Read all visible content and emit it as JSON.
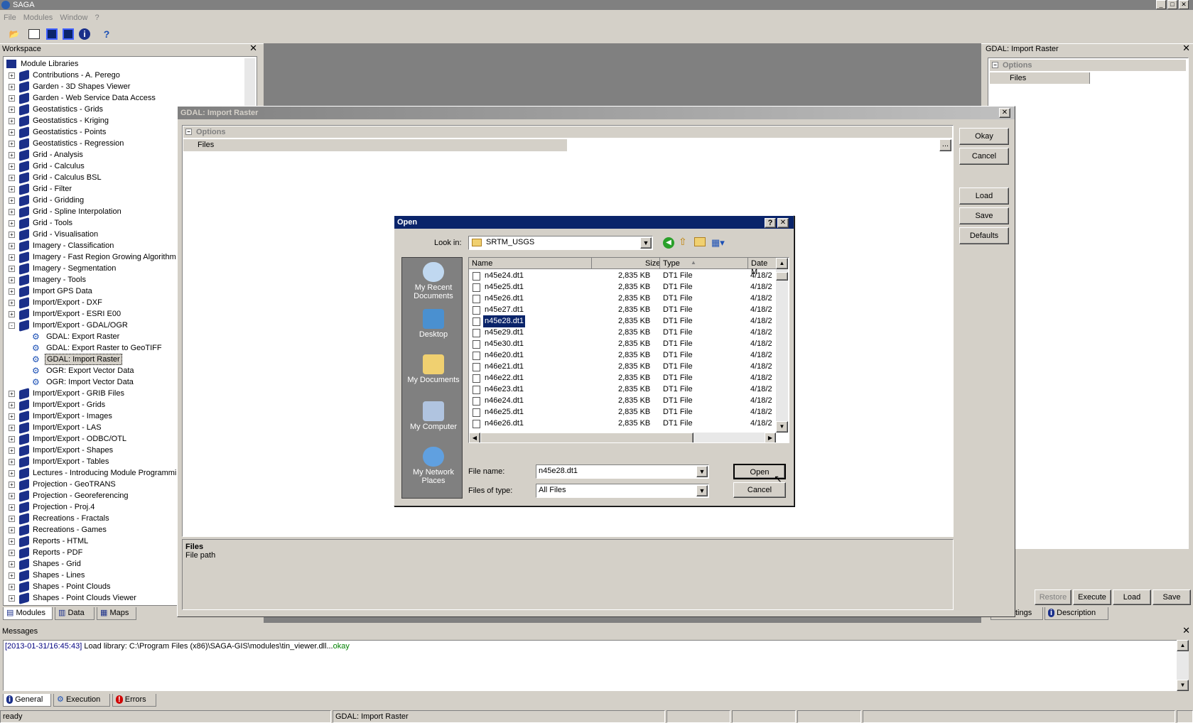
{
  "app": {
    "title": "SAGA",
    "window_buttons": [
      "_",
      "□",
      "✕"
    ]
  },
  "menu": [
    "File",
    "Modules",
    "Window",
    "?"
  ],
  "toolbar_icons": [
    "open-icon",
    "console-icon",
    "window-blue-icon",
    "window-blue2-icon",
    "info-icon",
    "help-icon"
  ],
  "workspace": {
    "title": "Workspace",
    "root": "Module Libraries",
    "items": [
      {
        "label": "Contributions - A. Perego",
        "exp": "+"
      },
      {
        "label": "Garden - 3D Shapes Viewer",
        "exp": "+"
      },
      {
        "label": "Garden - Web Service Data Access",
        "exp": "+"
      },
      {
        "label": "Geostatistics - Grids",
        "exp": "+"
      },
      {
        "label": "Geostatistics - Kriging",
        "exp": "+"
      },
      {
        "label": "Geostatistics - Points",
        "exp": "+"
      },
      {
        "label": "Geostatistics - Regression",
        "exp": "+"
      },
      {
        "label": "Grid - Analysis",
        "exp": "+"
      },
      {
        "label": "Grid - Calculus",
        "exp": "+"
      },
      {
        "label": "Grid - Calculus BSL",
        "exp": "+"
      },
      {
        "label": "Grid - Filter",
        "exp": "+"
      },
      {
        "label": "Grid - Gridding",
        "exp": "+"
      },
      {
        "label": "Grid - Spline Interpolation",
        "exp": "+"
      },
      {
        "label": "Grid - Tools",
        "exp": "+"
      },
      {
        "label": "Grid - Visualisation",
        "exp": "+"
      },
      {
        "label": "Imagery - Classification",
        "exp": "+"
      },
      {
        "label": "Imagery - Fast Region Growing Algorithm",
        "exp": "+"
      },
      {
        "label": "Imagery - Segmentation",
        "exp": "+"
      },
      {
        "label": "Imagery - Tools",
        "exp": "+"
      },
      {
        "label": "Import GPS Data",
        "exp": "+"
      },
      {
        "label": "Import/Export - DXF",
        "exp": "+"
      },
      {
        "label": "Import/Export - ESRI E00",
        "exp": "+"
      },
      {
        "label": "Import/Export - GDAL/OGR",
        "exp": "-"
      },
      {
        "label": "GDAL: Export Raster",
        "child": true
      },
      {
        "label": "GDAL: Export Raster to GeoTIFF",
        "child": true
      },
      {
        "label": "GDAL: Import Raster",
        "child": true,
        "selected": true
      },
      {
        "label": "OGR: Export Vector Data",
        "child": true
      },
      {
        "label": "OGR: Import Vector Data",
        "child": true
      },
      {
        "label": "Import/Export - GRIB Files",
        "exp": "+"
      },
      {
        "label": "Import/Export - Grids",
        "exp": "+"
      },
      {
        "label": "Import/Export - Images",
        "exp": "+"
      },
      {
        "label": "Import/Export - LAS",
        "exp": "+"
      },
      {
        "label": "Import/Export - ODBC/OTL",
        "exp": "+"
      },
      {
        "label": "Import/Export - Shapes",
        "exp": "+"
      },
      {
        "label": "Import/Export - Tables",
        "exp": "+"
      },
      {
        "label": "Lectures - Introducing Module Programmin",
        "exp": "+"
      },
      {
        "label": "Projection - GeoTRANS",
        "exp": "+"
      },
      {
        "label": "Projection - Georeferencing",
        "exp": "+"
      },
      {
        "label": "Projection - Proj.4",
        "exp": "+"
      },
      {
        "label": "Recreations - Fractals",
        "exp": "+"
      },
      {
        "label": "Recreations - Games",
        "exp": "+"
      },
      {
        "label": "Reports - HTML",
        "exp": "+"
      },
      {
        "label": "Reports - PDF",
        "exp": "+"
      },
      {
        "label": "Shapes - Grid",
        "exp": "+"
      },
      {
        "label": "Shapes - Lines",
        "exp": "+"
      },
      {
        "label": "Shapes - Point Clouds",
        "exp": "+"
      },
      {
        "label": "Shapes - Point Clouds Viewer",
        "exp": "+"
      }
    ],
    "tabs": [
      "Modules",
      "Data",
      "Maps"
    ]
  },
  "right_panel": {
    "title": "GDAL: Import Raster",
    "options": "Options",
    "files": "Files",
    "buttons": [
      "Restore",
      "Execute",
      "Load",
      "Save"
    ],
    "tabs": [
      "Settings",
      "Description"
    ]
  },
  "import_dialog": {
    "title": "GDAL: Import Raster",
    "options": "Options",
    "files": "Files",
    "browse": "...",
    "buttons": {
      "okay": "Okay",
      "cancel": "Cancel",
      "load": "Load",
      "save": "Save",
      "defaults": "Defaults"
    },
    "desc_title": "Files",
    "desc_text": "File path"
  },
  "open_dialog": {
    "title": "Open",
    "help": "?",
    "look_in_label": "Look in:",
    "look_in_value": "SRTM_USGS",
    "places": [
      "My Recent Documents",
      "Desktop",
      "My Documents",
      "My Computer",
      "My Network Places"
    ],
    "columns": {
      "name": "Name",
      "size": "Size",
      "type": "Type",
      "date": "Date M"
    },
    "files": [
      {
        "name": "n45e24.dt1",
        "size": "2,835 KB",
        "type": "DT1 File",
        "date": "4/18/2"
      },
      {
        "name": "n45e25.dt1",
        "size": "2,835 KB",
        "type": "DT1 File",
        "date": "4/18/2"
      },
      {
        "name": "n45e26.dt1",
        "size": "2,835 KB",
        "type": "DT1 File",
        "date": "4/18/2"
      },
      {
        "name": "n45e27.dt1",
        "size": "2,835 KB",
        "type": "DT1 File",
        "date": "4/18/2"
      },
      {
        "name": "n45e28.dt1",
        "size": "2,835 KB",
        "type": "DT1 File",
        "date": "4/18/2",
        "selected": true
      },
      {
        "name": "n45e29.dt1",
        "size": "2,835 KB",
        "type": "DT1 File",
        "date": "4/18/2"
      },
      {
        "name": "n45e30.dt1",
        "size": "2,835 KB",
        "type": "DT1 File",
        "date": "4/18/2"
      },
      {
        "name": "n46e20.dt1",
        "size": "2,835 KB",
        "type": "DT1 File",
        "date": "4/18/2"
      },
      {
        "name": "n46e21.dt1",
        "size": "2,835 KB",
        "type": "DT1 File",
        "date": "4/18/2"
      },
      {
        "name": "n46e22.dt1",
        "size": "2,835 KB",
        "type": "DT1 File",
        "date": "4/18/2"
      },
      {
        "name": "n46e23.dt1",
        "size": "2,835 KB",
        "type": "DT1 File",
        "date": "4/18/2"
      },
      {
        "name": "n46e24.dt1",
        "size": "2,835 KB",
        "type": "DT1 File",
        "date": "4/18/2"
      },
      {
        "name": "n46e25.dt1",
        "size": "2,835 KB",
        "type": "DT1 File",
        "date": "4/18/2"
      },
      {
        "name": "n46e26.dt1",
        "size": "2,835 KB",
        "type": "DT1 File",
        "date": "4/18/2"
      }
    ],
    "file_name_label": "File name:",
    "file_name_value": "n45e28.dt1",
    "files_of_type_label": "Files of type:",
    "files_of_type_value": "All Files",
    "open_btn": "Open",
    "cancel_btn": "Cancel"
  },
  "messages": {
    "title": "Messages",
    "timestamp": "[2013-01-31/16:45:43]",
    "text": " Load library: C:\\Program Files (x86)\\SAGA-GIS\\modules\\tin_viewer.dll...",
    "status": "okay",
    "tabs": [
      "General",
      "Execution",
      "Errors"
    ]
  },
  "statusbar": {
    "left": "ready",
    "center": "GDAL: Import Raster"
  },
  "colors": {
    "selection": "#0a246a",
    "okay": "#008000",
    "timestamp": "#000080"
  }
}
